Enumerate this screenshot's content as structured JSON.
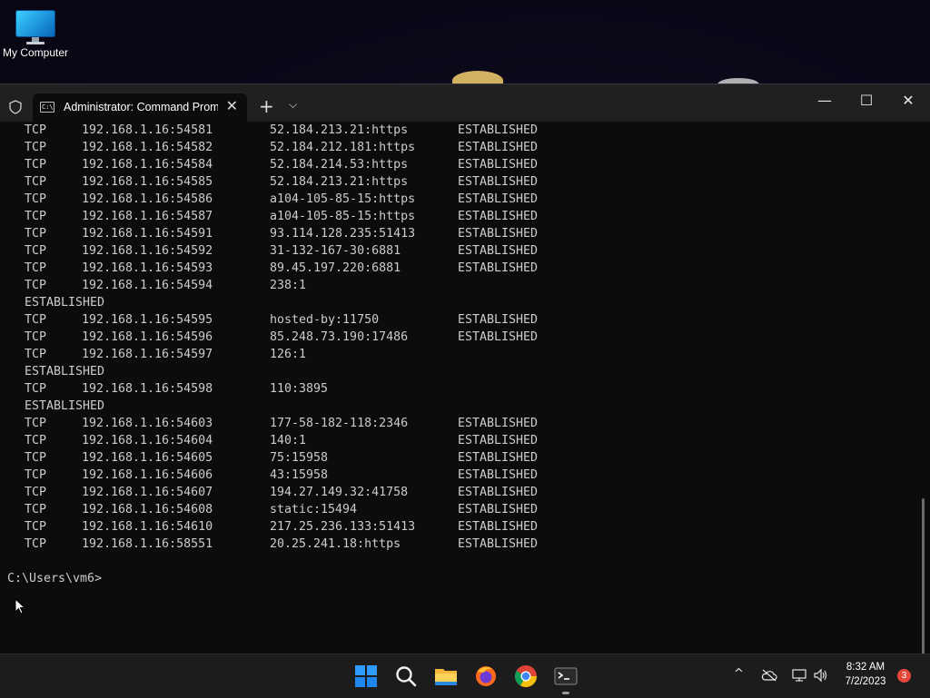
{
  "desktop": {
    "icon_label": "My Computer"
  },
  "window": {
    "tab_title": "Administrator:  Command Prompt",
    "tab_close": "✕",
    "new_tab": "+",
    "dropdown": "⌵",
    "minimize": "—",
    "maximize": "☐",
    "close": "✕"
  },
  "terminal": {
    "rows": [
      [
        "TCP",
        "192.168.1.16:54581",
        "52.184.213.21:https",
        "ESTABLISHED"
      ],
      [
        "TCP",
        "192.168.1.16:54582",
        "52.184.212.181:https",
        "ESTABLISHED"
      ],
      [
        "TCP",
        "192.168.1.16:54584",
        "52.184.214.53:https",
        "ESTABLISHED"
      ],
      [
        "TCP",
        "192.168.1.16:54585",
        "52.184.213.21:https",
        "ESTABLISHED"
      ],
      [
        "TCP",
        "192.168.1.16:54586",
        "a104-105-85-15:https",
        "ESTABLISHED"
      ],
      [
        "TCP",
        "192.168.1.16:54587",
        "a104-105-85-15:https",
        "ESTABLISHED"
      ],
      [
        "TCP",
        "192.168.1.16:54591",
        "93.114.128.235:51413",
        "ESTABLISHED"
      ],
      [
        "TCP",
        "192.168.1.16:54592",
        "31-132-167-30:6881",
        "ESTABLISHED"
      ],
      [
        "TCP",
        "192.168.1.16:54593",
        "89.45.197.220:6881",
        "ESTABLISHED"
      ],
      [
        "TCP",
        "192.168.1.16:54594",
        "238:1",
        ""
      ],
      [
        "ESTABLISHED",
        "",
        "",
        ""
      ],
      [
        "TCP",
        "192.168.1.16:54595",
        "hosted-by:11750",
        "ESTABLISHED"
      ],
      [
        "TCP",
        "192.168.1.16:54596",
        "85.248.73.190:17486",
        "ESTABLISHED"
      ],
      [
        "TCP",
        "192.168.1.16:54597",
        "126:1",
        ""
      ],
      [
        "ESTABLISHED",
        "",
        "",
        ""
      ],
      [
        "TCP",
        "192.168.1.16:54598",
        "110:3895",
        ""
      ],
      [
        "ESTABLISHED",
        "",
        "",
        ""
      ],
      [
        "TCP",
        "192.168.1.16:54603",
        "177-58-182-118:2346",
        "ESTABLISHED"
      ],
      [
        "TCP",
        "192.168.1.16:54604",
        "140:1",
        "ESTABLISHED"
      ],
      [
        "TCP",
        "192.168.1.16:54605",
        "75:15958",
        "ESTABLISHED"
      ],
      [
        "TCP",
        "192.168.1.16:54606",
        "43:15958",
        "ESTABLISHED"
      ],
      [
        "TCP",
        "192.168.1.16:54607",
        "194.27.149.32:41758",
        "ESTABLISHED"
      ],
      [
        "TCP",
        "192.168.1.16:54608",
        "static:15494",
        "ESTABLISHED"
      ],
      [
        "TCP",
        "192.168.1.16:54610",
        "217.25.236.133:51413",
        "ESTABLISHED"
      ],
      [
        "TCP",
        "192.168.1.16:58551",
        "20.25.241.18:https",
        "ESTABLISHED"
      ]
    ],
    "prompt": "C:\\Users\\vm6>"
  },
  "taskbar": {
    "apps": [
      "start-icon",
      "search-icon",
      "file-explorer-icon",
      "firefox-icon",
      "chrome-icon",
      "terminal-icon"
    ],
    "clock_time": "8:32 AM",
    "clock_date": "7/2/2023",
    "notification_count": "3",
    "tray_chevron": "^"
  },
  "colors": {
    "terminal_bg": "#0c0c0c",
    "terminal_text": "#cccccc",
    "titlebar_bg": "#202020",
    "taskbar_bg": "#1c1c1c",
    "notification_badge": "#e5483a"
  }
}
